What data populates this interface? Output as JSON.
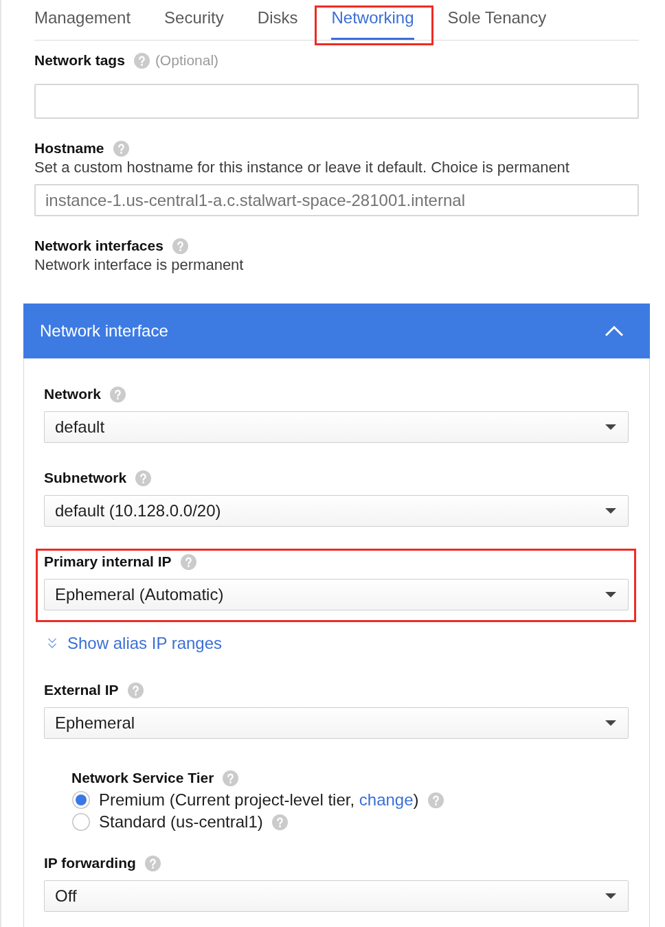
{
  "tabs": [
    {
      "label": "Management",
      "selected": false,
      "highlighted": false
    },
    {
      "label": "Security",
      "selected": false,
      "highlighted": false
    },
    {
      "label": "Disks",
      "selected": false,
      "highlighted": false
    },
    {
      "label": "Networking",
      "selected": true,
      "highlighted": true
    },
    {
      "label": "Sole Tenancy",
      "selected": false,
      "highlighted": false
    }
  ],
  "network_tags": {
    "label": "Network tags",
    "note": "(Optional)"
  },
  "hostname": {
    "label": "Hostname",
    "description": "Set a custom hostname for this instance or leave it default. Choice is permanent",
    "placeholder": "instance-1.us-central1-a.c.stalwart-space-281001.internal"
  },
  "network_interfaces": {
    "label": "Network interfaces",
    "description": "Network interface is permanent"
  },
  "network_interface": {
    "title": "Network interface",
    "expanded": true,
    "items": [
      {
        "kind": "select",
        "label": "Network",
        "value": "default",
        "highlighted": false
      },
      {
        "kind": "select",
        "label": "Subnetwork",
        "value": "default (10.128.0.0/20)",
        "highlighted": false
      },
      {
        "kind": "select",
        "label": "Primary internal IP",
        "value": "Ephemeral (Automatic)",
        "highlighted": true
      },
      {
        "kind": "link",
        "label": "Show alias IP ranges"
      },
      {
        "kind": "select",
        "label": "External IP",
        "value": "Ephemeral",
        "highlighted": false
      },
      {
        "kind": "radio_group",
        "label": "Network Service Tier",
        "options": [
          {
            "text": "Premium (Current project-level tier, ",
            "link": "change",
            "text_after": ")",
            "selected": true
          },
          {
            "text": "Standard (us-central1)",
            "selected": false
          }
        ]
      },
      {
        "kind": "select",
        "label": "IP forwarding",
        "value": "Off",
        "highlighted": false
      }
    ]
  }
}
